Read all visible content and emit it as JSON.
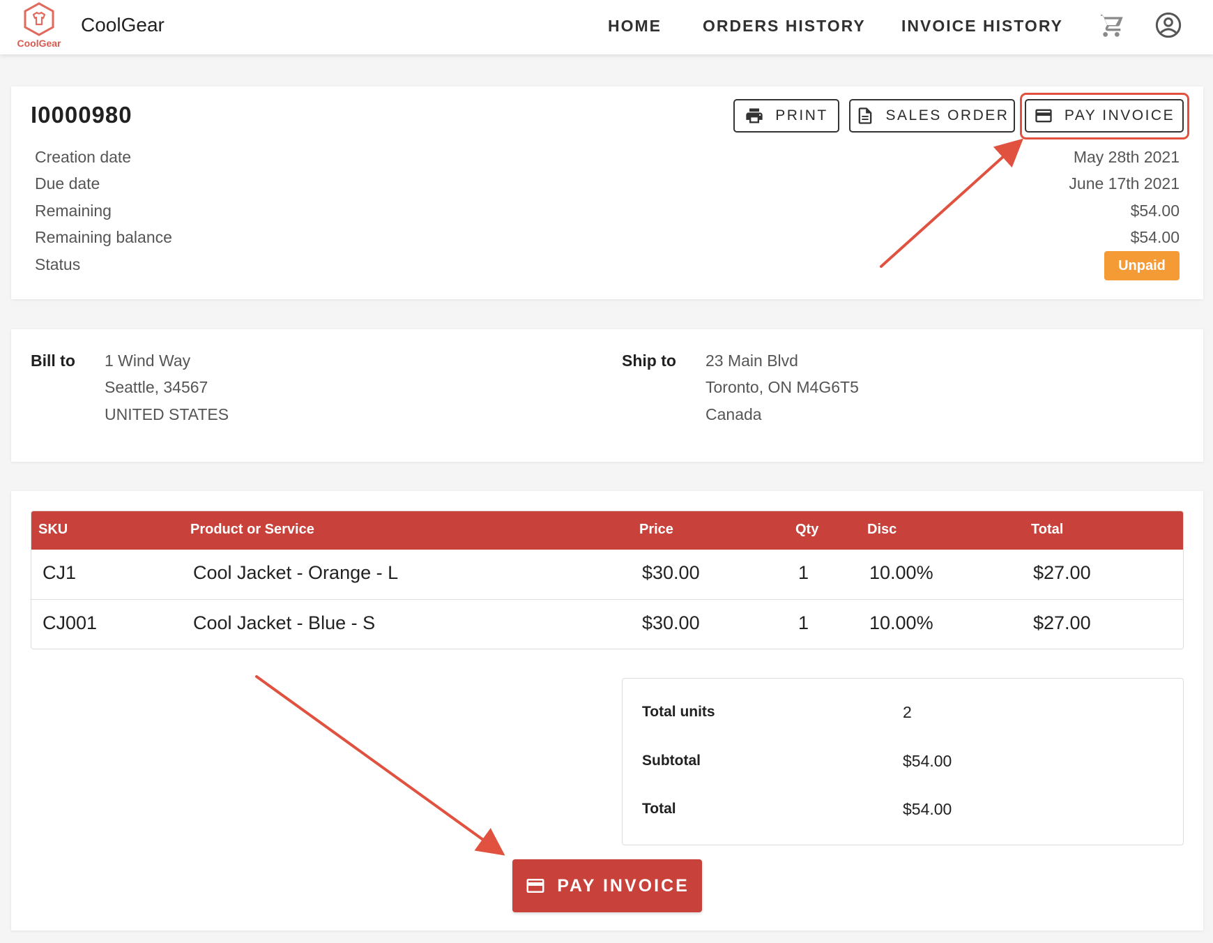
{
  "header": {
    "logo_text": "CoolGear",
    "brand_name": "CoolGear",
    "nav": {
      "home": "HOME",
      "orders_history": "ORDERS HISTORY",
      "invoice_history": "INVOICE HISTORY"
    },
    "icons": [
      "cart-icon",
      "account-icon"
    ]
  },
  "invoice": {
    "number": "I0000980",
    "actions": {
      "print": "PRINT",
      "sales_order": "SALES ORDER",
      "pay_invoice": "PAY INVOICE"
    },
    "fields": {
      "creation_date_label": "Creation date",
      "creation_date": "May 28th 2021",
      "due_date_label": "Due date",
      "due_date": "June 17th 2021",
      "remaining_label": "Remaining",
      "remaining": "$54.00",
      "remaining_balance_label": "Remaining balance",
      "remaining_balance": "$54.00",
      "status_label": "Status",
      "status": "Unpaid"
    }
  },
  "addresses": {
    "bill_to_label": "Bill to",
    "bill_to": [
      "1 Wind Way",
      "Seattle, 34567",
      "UNITED STATES"
    ],
    "ship_to_label": "Ship to",
    "ship_to": [
      "23 Main Blvd",
      "Toronto, ON M4G6T5",
      "Canada"
    ]
  },
  "items": {
    "columns": [
      "SKU",
      "Product or Service",
      "Price",
      "Qty",
      "Disc",
      "Total"
    ],
    "rows": [
      [
        "CJ1",
        "Cool Jacket - Orange - L",
        "$30.00",
        "1",
        "10.00%",
        "$27.00"
      ],
      [
        "CJ001",
        "Cool Jacket - Blue - S",
        "$30.00",
        "1",
        "10.00%",
        "$27.00"
      ]
    ]
  },
  "summary": {
    "total_units_label": "Total units",
    "total_units": "2",
    "subtotal_label": "Subtotal",
    "subtotal": "$54.00",
    "total_label": "Total",
    "total": "$54.00"
  },
  "pay_button": "PAY INVOICE",
  "colors": {
    "primary": "#c9413b",
    "status_unpaid": "#f59b36",
    "annotation": "#e0523f"
  }
}
